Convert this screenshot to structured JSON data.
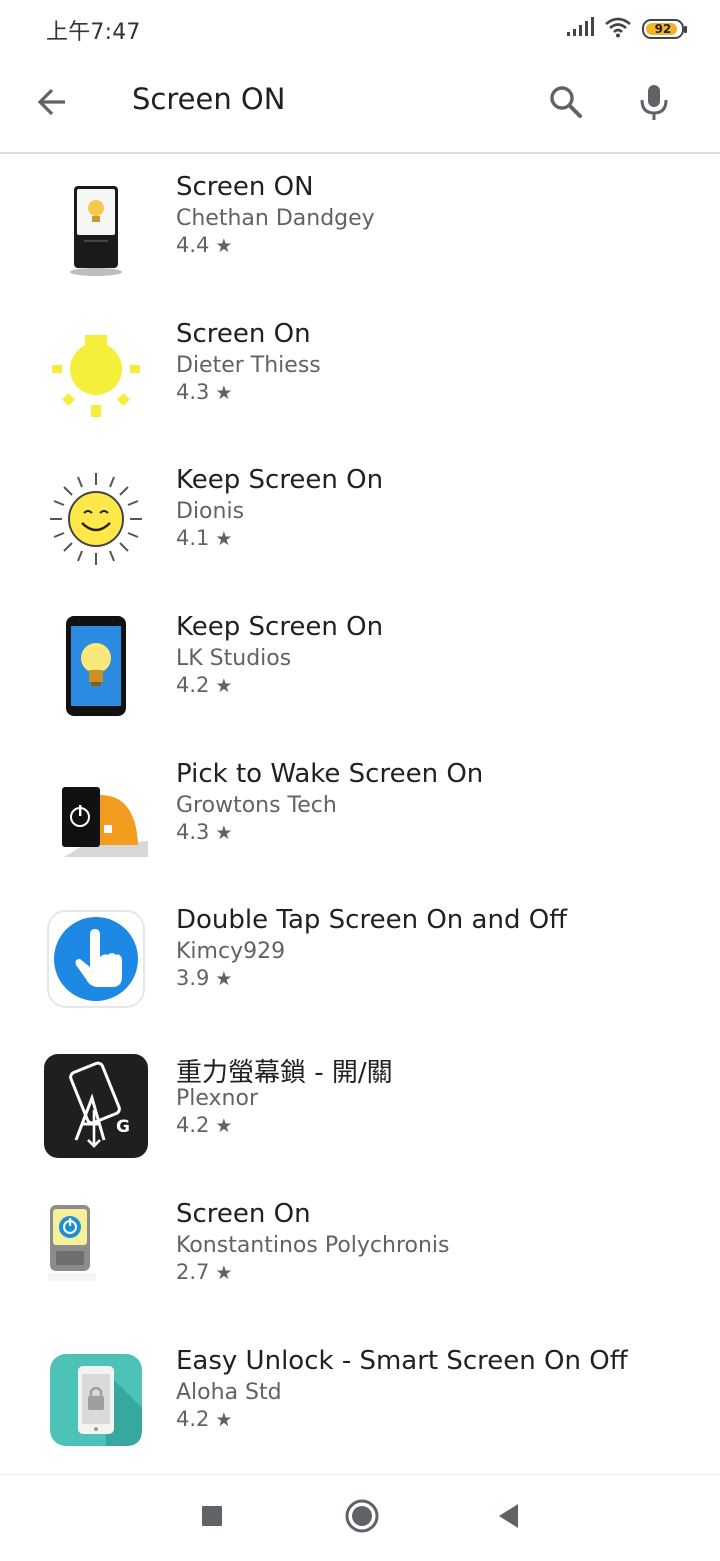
{
  "status_bar": {
    "time": "上午7:47",
    "battery": "92",
    "battery_fraction": 0.92,
    "icons": [
      "signal-icon",
      "wifi-icon",
      "battery-icon"
    ]
  },
  "app_bar": {
    "query": "Screen ON",
    "back_icon": "back-arrow-icon",
    "search_icon": "search-icon",
    "mic_icon": "mic-icon"
  },
  "results": [
    {
      "title": "Screen ON",
      "developer": "Chethan Dandgey",
      "rating": "4.4",
      "icon": "lamp-device-icon"
    },
    {
      "title": "Screen On",
      "developer": "Dieter Thiess",
      "rating": "4.3",
      "icon": "yellow-bulb-icon"
    },
    {
      "title": "Keep Screen On",
      "developer": "Dionis",
      "rating": "4.1",
      "icon": "smiling-sun-icon"
    },
    {
      "title": "Keep Screen On",
      "developer": "LK Studios",
      "rating": "4.2",
      "icon": "phone-bulb-icon"
    },
    {
      "title": "Pick to Wake Screen On",
      "developer": "Growtons Tech",
      "rating": "4.3",
      "icon": "power-phone-icon"
    },
    {
      "title": "Double Tap Screen On and Off",
      "developer": "Kimcy929",
      "rating": "3.9",
      "icon": "tap-hand-icon"
    },
    {
      "title": "重力螢幕鎖 - 開/關",
      "developer": "Plexnor",
      "rating": "4.2",
      "icon": "gravity-lock-icon"
    },
    {
      "title": "Screen On",
      "developer": "Konstantinos Polychronis",
      "rating": "2.7",
      "icon": "power-device-icon"
    },
    {
      "title": "Easy Unlock - Smart Screen On Off",
      "developer": "Aloha Std",
      "rating": "4.2",
      "icon": "unlock-phone-icon"
    }
  ],
  "rating_star": "★",
  "nav_bar": {
    "icons": [
      "recents-square-icon",
      "home-circle-icon",
      "back-triangle-icon"
    ]
  },
  "colors": {
    "divider": "#dadce0",
    "secondary_text": "#5f6368",
    "battery_fill": "#f0b429",
    "tap_blue": "#1e88e5",
    "bulb_yellow": "#f5ee3a"
  }
}
